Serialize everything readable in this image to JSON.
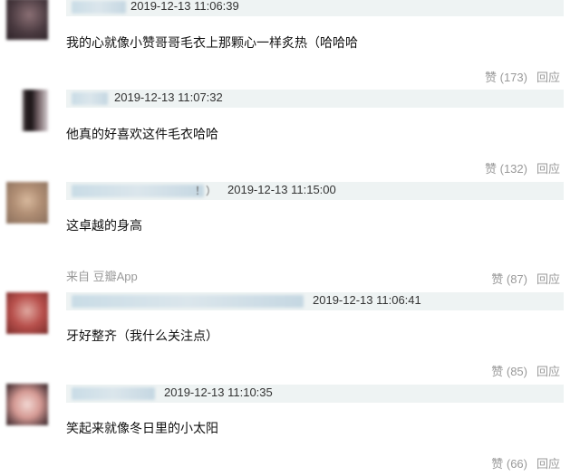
{
  "comments": [
    {
      "time": "2019-12-13 11:06:39",
      "text": "我的心就像小赞哥哥毛衣上那颗心一样炙热（哈哈哈",
      "like": "赞 (173)",
      "reply": "回应"
    },
    {
      "time": "2019-12-13 11:07:32",
      "text": "他真的好喜欢这件毛衣哈哈",
      "like": "赞 (132)",
      "reply": "回应"
    },
    {
      "name_tail": "！）",
      "time": "2019-12-13 11:15:00",
      "text": "这卓越的身高",
      "source": "来自 豆瓣App",
      "like": "赞 (87)",
      "reply": "回应"
    },
    {
      "time": "2019-12-13 11:06:41",
      "text": "牙好整齐（我什么关注点）",
      "like": "赞 (85)",
      "reply": "回应"
    },
    {
      "time": "2019-12-13 11:10:35",
      "text": "笑起来就像冬日里的小太阳",
      "like": "赞 (66)",
      "reply": "回应"
    }
  ]
}
